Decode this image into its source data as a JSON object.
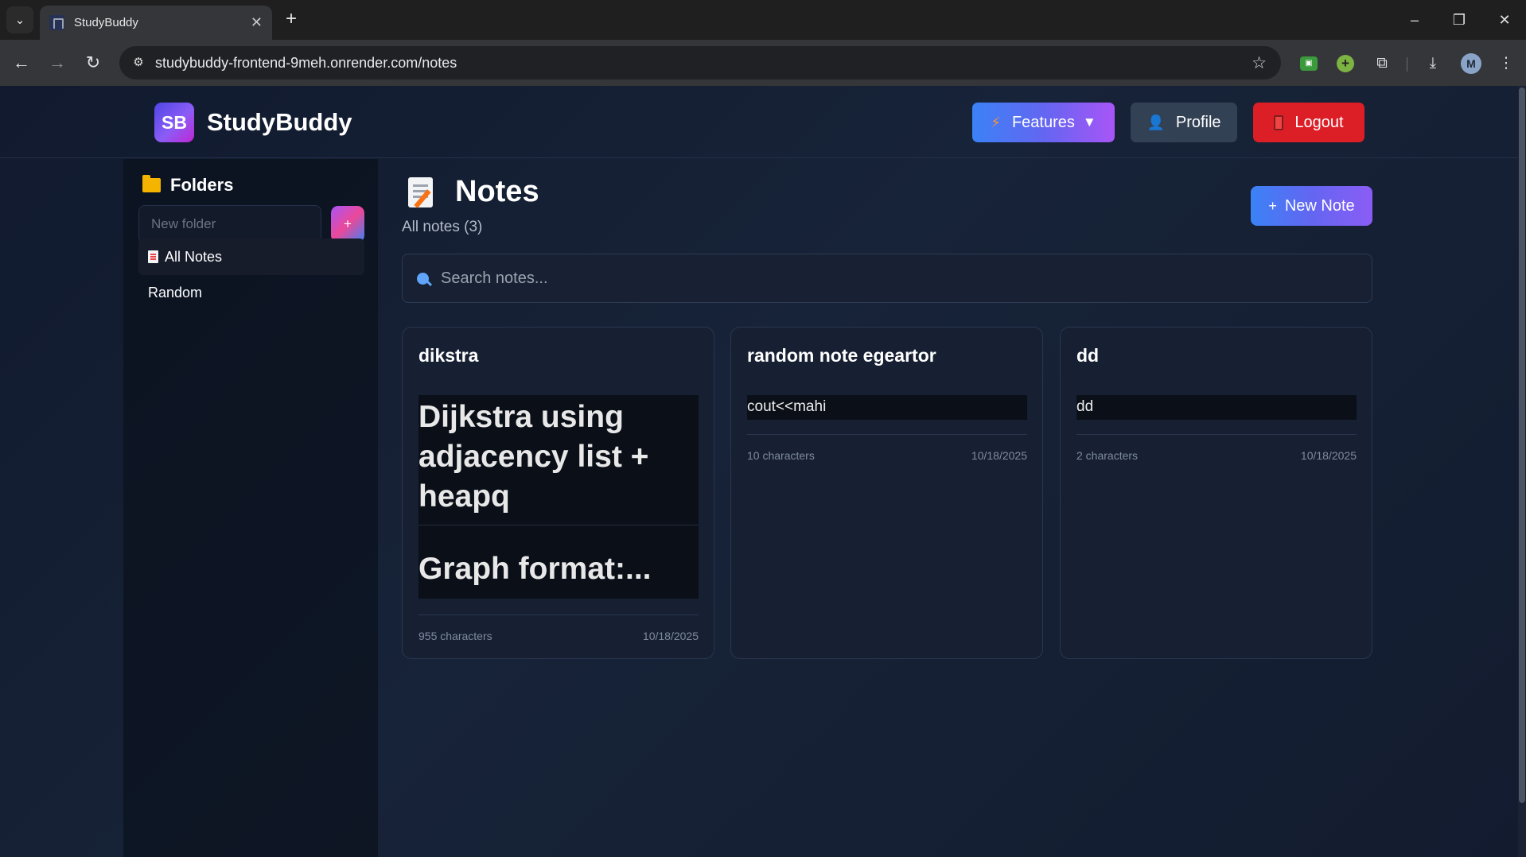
{
  "browser": {
    "tab_title": "StudyBuddy",
    "url": "studybuddy-frontend-9meh.onrender.com/notes",
    "profile_initial": "M"
  },
  "header": {
    "logo_badge": "SB",
    "logo_text": "StudyBuddy",
    "features_label": "Features",
    "profile_label": "Profile",
    "logout_label": "Logout"
  },
  "sidebar": {
    "title": "Folders",
    "new_folder_placeholder": "New folder",
    "add_label": "+",
    "folders": [
      {
        "label": "All Notes",
        "active": true
      },
      {
        "label": "Random",
        "active": false
      }
    ]
  },
  "main": {
    "title": "Notes",
    "subtitle": "All notes (3)",
    "new_note_label": "New Note",
    "search_placeholder": "Search notes...",
    "notes": [
      {
        "title": "dikstra",
        "preview_heading": "Dijkstra using adjacency list + heapq",
        "preview_sub": "Graph format:...",
        "chars": "955 characters",
        "date": "10/18/2025"
      },
      {
        "title": "random note egeartor",
        "preview": "cout<<mahi",
        "chars": "10 characters",
        "date": "10/18/2025"
      },
      {
        "title": "dd",
        "preview": "dd",
        "chars": "2 characters",
        "date": "10/18/2025"
      }
    ]
  },
  "colors": {
    "logout": "#dc1f26",
    "accent_blue": "#3b82f6",
    "accent_purple": "#a855f7"
  }
}
